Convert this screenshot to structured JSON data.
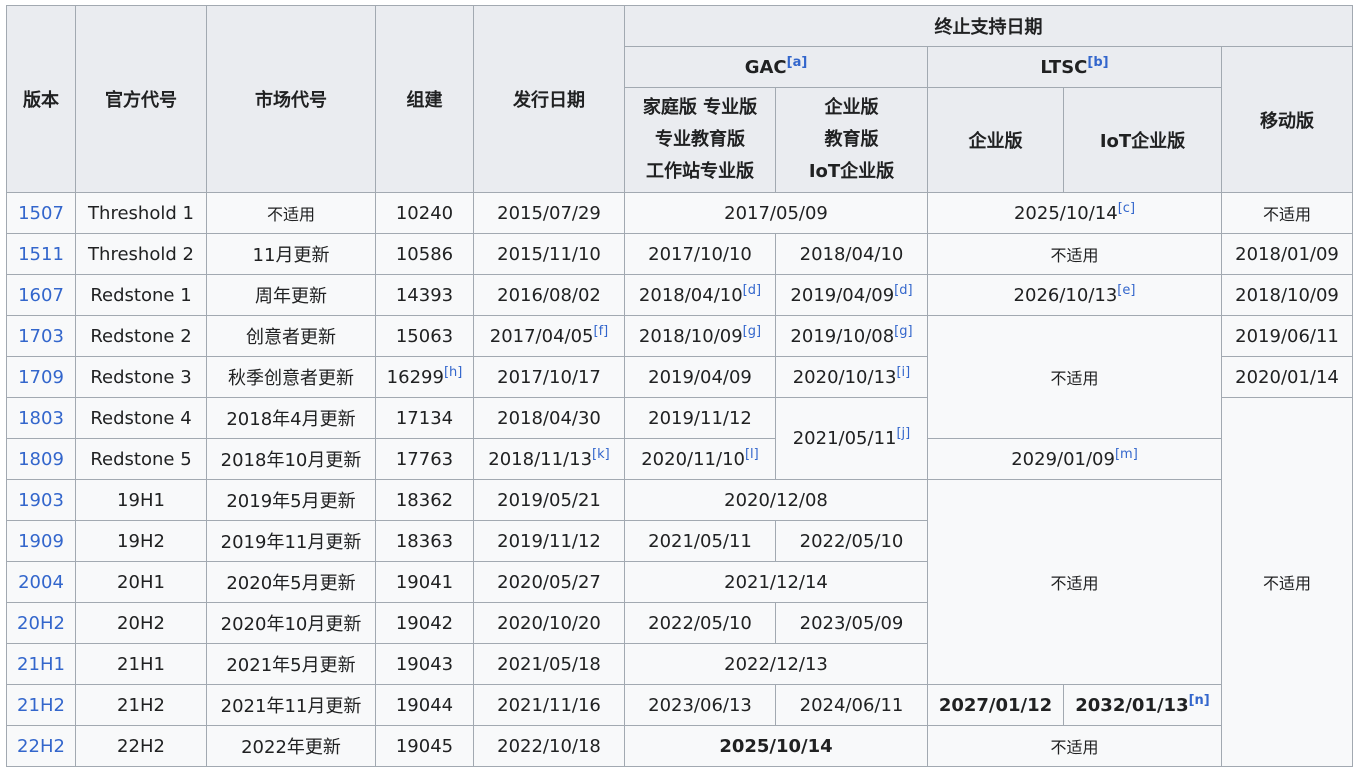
{
  "header": {
    "version": "版本",
    "codename": "官方代号",
    "marketing": "市场代号",
    "build": "组建",
    "release": "发行日期",
    "eos": "终止支持日期",
    "gac": "GAC",
    "gac_note": "[a]",
    "ltsc": "LTSC",
    "ltsc_note": "[b]",
    "gac_home_1": "家庭版 专业版",
    "gac_home_2": "专业教育版",
    "gac_home_3": "工作站专业版",
    "gac_ent_1": "企业版",
    "gac_ent_2": "教育版",
    "gac_ent_3": "IoT企业版",
    "ltsc_ent": "企业版",
    "ltsc_iot": "IoT企业版",
    "mobile": "移动版"
  },
  "na": "不适用",
  "rows": [
    {
      "version": "1507",
      "codename": "Threshold 1",
      "marketing": "不适用",
      "build": "10240",
      "release": "2015/07/29",
      "gac_merged": "2017/05/09",
      "ltsc_merged": "2025/10/14",
      "ltsc_note": "[c]",
      "mobile": "不适用"
    },
    {
      "version": "1511",
      "codename": "Threshold 2",
      "marketing": "11月更新",
      "build": "10586",
      "release": "2015/11/10",
      "gac_home": "2017/10/10",
      "gac_ent": "2018/04/10",
      "ltsc_merged": "不适用",
      "mobile": "2018/01/09"
    },
    {
      "version": "1607",
      "codename": "Redstone 1",
      "marketing": "周年更新",
      "build": "14393",
      "release": "2016/08/02",
      "gac_home": "2018/04/10",
      "gac_home_note": "[d]",
      "gac_ent": "2019/04/09",
      "gac_ent_note": "[d]",
      "ltsc_merged": "2026/10/13",
      "ltsc_note": "[e]",
      "mobile": "2018/10/09"
    },
    {
      "version": "1703",
      "codename": "Redstone 2",
      "marketing": "创意者更新",
      "build": "15063",
      "release": "2017/04/05",
      "release_note": "[f]",
      "gac_home": "2018/10/09",
      "gac_home_note": "[g]",
      "gac_ent": "2019/10/08",
      "gac_ent_note": "[g]",
      "ltsc_merged": "不适用",
      "mobile": "2019/06/11"
    },
    {
      "version": "1709",
      "codename": "Redstone 3",
      "marketing": "秋季创意者更新",
      "build": "16299",
      "build_note": "[h]",
      "release": "2017/10/17",
      "gac_home": "2019/04/09",
      "gac_ent": "2020/10/13",
      "gac_ent_note": "[i]",
      "mobile": "2020/01/14"
    },
    {
      "version": "1803",
      "codename": "Redstone 4",
      "marketing": "2018年4月更新",
      "build": "17134",
      "release": "2018/04/30",
      "gac_home": "2019/11/12",
      "gac_ent": "2021/05/11",
      "gac_ent_note": "[j]",
      "mobile": "不适用"
    },
    {
      "version": "1809",
      "codename": "Redstone 5",
      "marketing": "2018年10月更新",
      "build": "17763",
      "release": "2018/11/13",
      "release_note": "[k]",
      "gac_home": "2020/11/10",
      "gac_home_note": "[l]",
      "ltsc_merged": "2029/01/09",
      "ltsc_note": "[m]"
    },
    {
      "version": "1903",
      "codename": "19H1",
      "marketing": "2019年5月更新",
      "build": "18362",
      "release": "2019/05/21",
      "gac_merged": "2020/12/08",
      "ltsc_merged": "不适用"
    },
    {
      "version": "1909",
      "codename": "19H2",
      "marketing": "2019年11月更新",
      "build": "18363",
      "release": "2019/11/12",
      "gac_home": "2021/05/11",
      "gac_ent": "2022/05/10"
    },
    {
      "version": "2004",
      "codename": "20H1",
      "marketing": "2020年5月更新",
      "build": "19041",
      "release": "2020/05/27",
      "gac_merged": "2021/12/14"
    },
    {
      "version": "20H2",
      "codename": "20H2",
      "marketing": "2020年10月更新",
      "build": "19042",
      "release": "2020/10/20",
      "gac_home": "2022/05/10",
      "gac_ent": "2023/05/09"
    },
    {
      "version": "21H1",
      "codename": "21H1",
      "marketing": "2021年5月更新",
      "build": "19043",
      "release": "2021/05/18",
      "gac_merged": "2022/12/13"
    },
    {
      "version": "21H2",
      "codename": "21H2",
      "marketing": "2021年11月更新",
      "build": "19044",
      "release": "2021/11/16",
      "gac_home": "2023/06/13",
      "gac_ent": "2024/06/11",
      "ltsc_ent": "2027/01/12",
      "ltsc_iot": "2032/01/13",
      "ltsc_iot_note": "[n]"
    },
    {
      "version": "22H2",
      "codename": "22H2",
      "marketing": "2022年更新",
      "build": "19045",
      "release": "2022/10/18",
      "gac_merged": "2025/10/14",
      "ltsc_merged": "不适用"
    }
  ],
  "colors": {
    "red": "#f8b0a8",
    "yellow": "#fffcc8",
    "green": "#d1f2b4",
    "header": "#eaecf0",
    "link": "#3366cc"
  }
}
